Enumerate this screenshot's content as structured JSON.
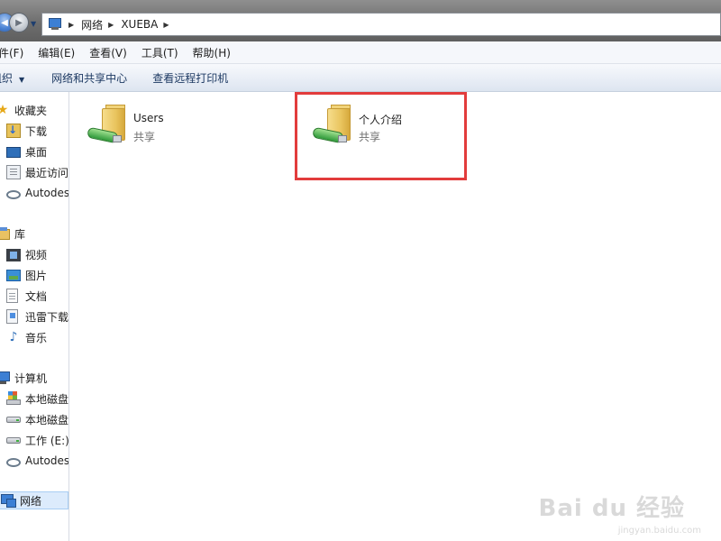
{
  "address": {
    "breadcrumbs": [
      "网络",
      "XUEBA"
    ]
  },
  "menu": {
    "items": [
      "件(F)",
      "编辑(E)",
      "查看(V)",
      "工具(T)",
      "帮助(H)"
    ]
  },
  "commands": {
    "organize": "组织",
    "network_center": "网络和共享中心",
    "remote_print": "查看远程打印机"
  },
  "nav": {
    "favorites": {
      "label": "收藏夹",
      "items": [
        "下载",
        "桌面",
        "最近访问",
        "Autodes"
      ]
    },
    "libraries": {
      "label": "库",
      "items": [
        "视频",
        "图片",
        "文档",
        "迅雷下载",
        "音乐"
      ]
    },
    "computer": {
      "label": "计算机",
      "items": [
        "本地磁盘",
        "本地磁盘",
        "工作 (E:)",
        "Autodes"
      ]
    },
    "network": {
      "label": "网络"
    }
  },
  "shares": [
    {
      "name": "Users",
      "type": "共享"
    },
    {
      "name": "个人介绍",
      "type": "共享"
    }
  ],
  "watermark": {
    "text": "Bai du 经验",
    "url": "jingyan.baidu.com"
  },
  "colors": {
    "highlight": "#e23c3c",
    "nav_selected": "#dcebfc"
  }
}
